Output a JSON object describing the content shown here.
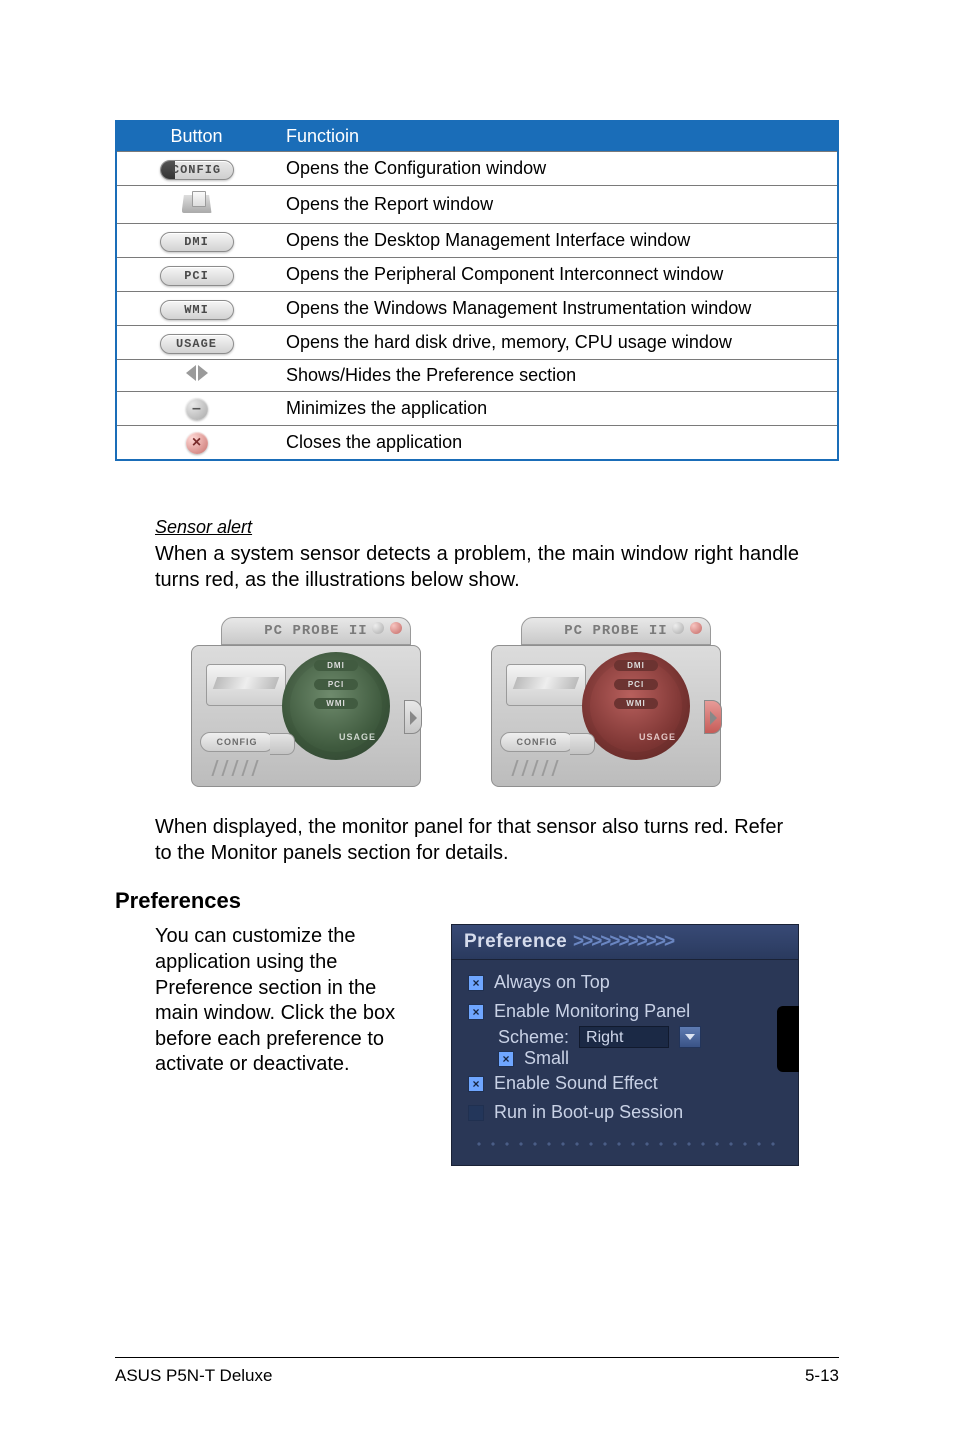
{
  "table": {
    "headers": {
      "button": "Button",
      "function": "Functioin"
    },
    "rows": [
      {
        "icon": "CONFIG",
        "label": "CONFIG",
        "desc": "Opens the Configuration window"
      },
      {
        "icon": "REPORT",
        "label": "",
        "desc": "Opens the Report window"
      },
      {
        "icon": "DMI",
        "label": "DMI",
        "desc": "Opens the Desktop Management Interface window"
      },
      {
        "icon": "PCI",
        "label": "PCI",
        "desc": "Opens the Peripheral Component Interconnect window"
      },
      {
        "icon": "WMI",
        "label": "WMI",
        "desc": "Opens the Windows Management Instrumentation window"
      },
      {
        "icon": "USAGE",
        "label": "USAGE",
        "desc": "Opens the hard disk drive, memory, CPU usage window"
      },
      {
        "icon": "TOGGLE",
        "label": "",
        "desc": "Shows/Hides the Preference section"
      },
      {
        "icon": "MINIMIZE",
        "label": "",
        "desc": "Minimizes the application"
      },
      {
        "icon": "CLOSE",
        "label": "",
        "desc": "Closes the application"
      }
    ]
  },
  "sensor": {
    "heading": "Sensor alert",
    "para1": "When a system sensor detects a problem, the main window right handle turns red, as the illustrations below show.",
    "para2": "When displayed, the monitor panel for that sensor also turns red. Refer to the Monitor panels section for details."
  },
  "widget": {
    "title": "PC PROBE II",
    "tags": [
      "DMI",
      "PCI",
      "WMI"
    ],
    "usage": "USAGE",
    "config": "CONFIG"
  },
  "preferences": {
    "heading": "Preferences",
    "text": "You can customize the application using the Preference section in the main window. Click the box before each preference to activate or deactivate.",
    "panel_title": "Preference",
    "chevrons": ">>>>>>>>>>>",
    "items": {
      "always_on_top": "Always on Top",
      "enable_monitoring": "Enable Monitoring Panel",
      "scheme_label": "Scheme:",
      "scheme_value": "Right",
      "small": "Small",
      "enable_sound": "Enable Sound Effect",
      "run_boot": "Run in Boot-up Session"
    }
  },
  "footer": {
    "left": "ASUS P5N-T Deluxe",
    "right": "5-13"
  }
}
